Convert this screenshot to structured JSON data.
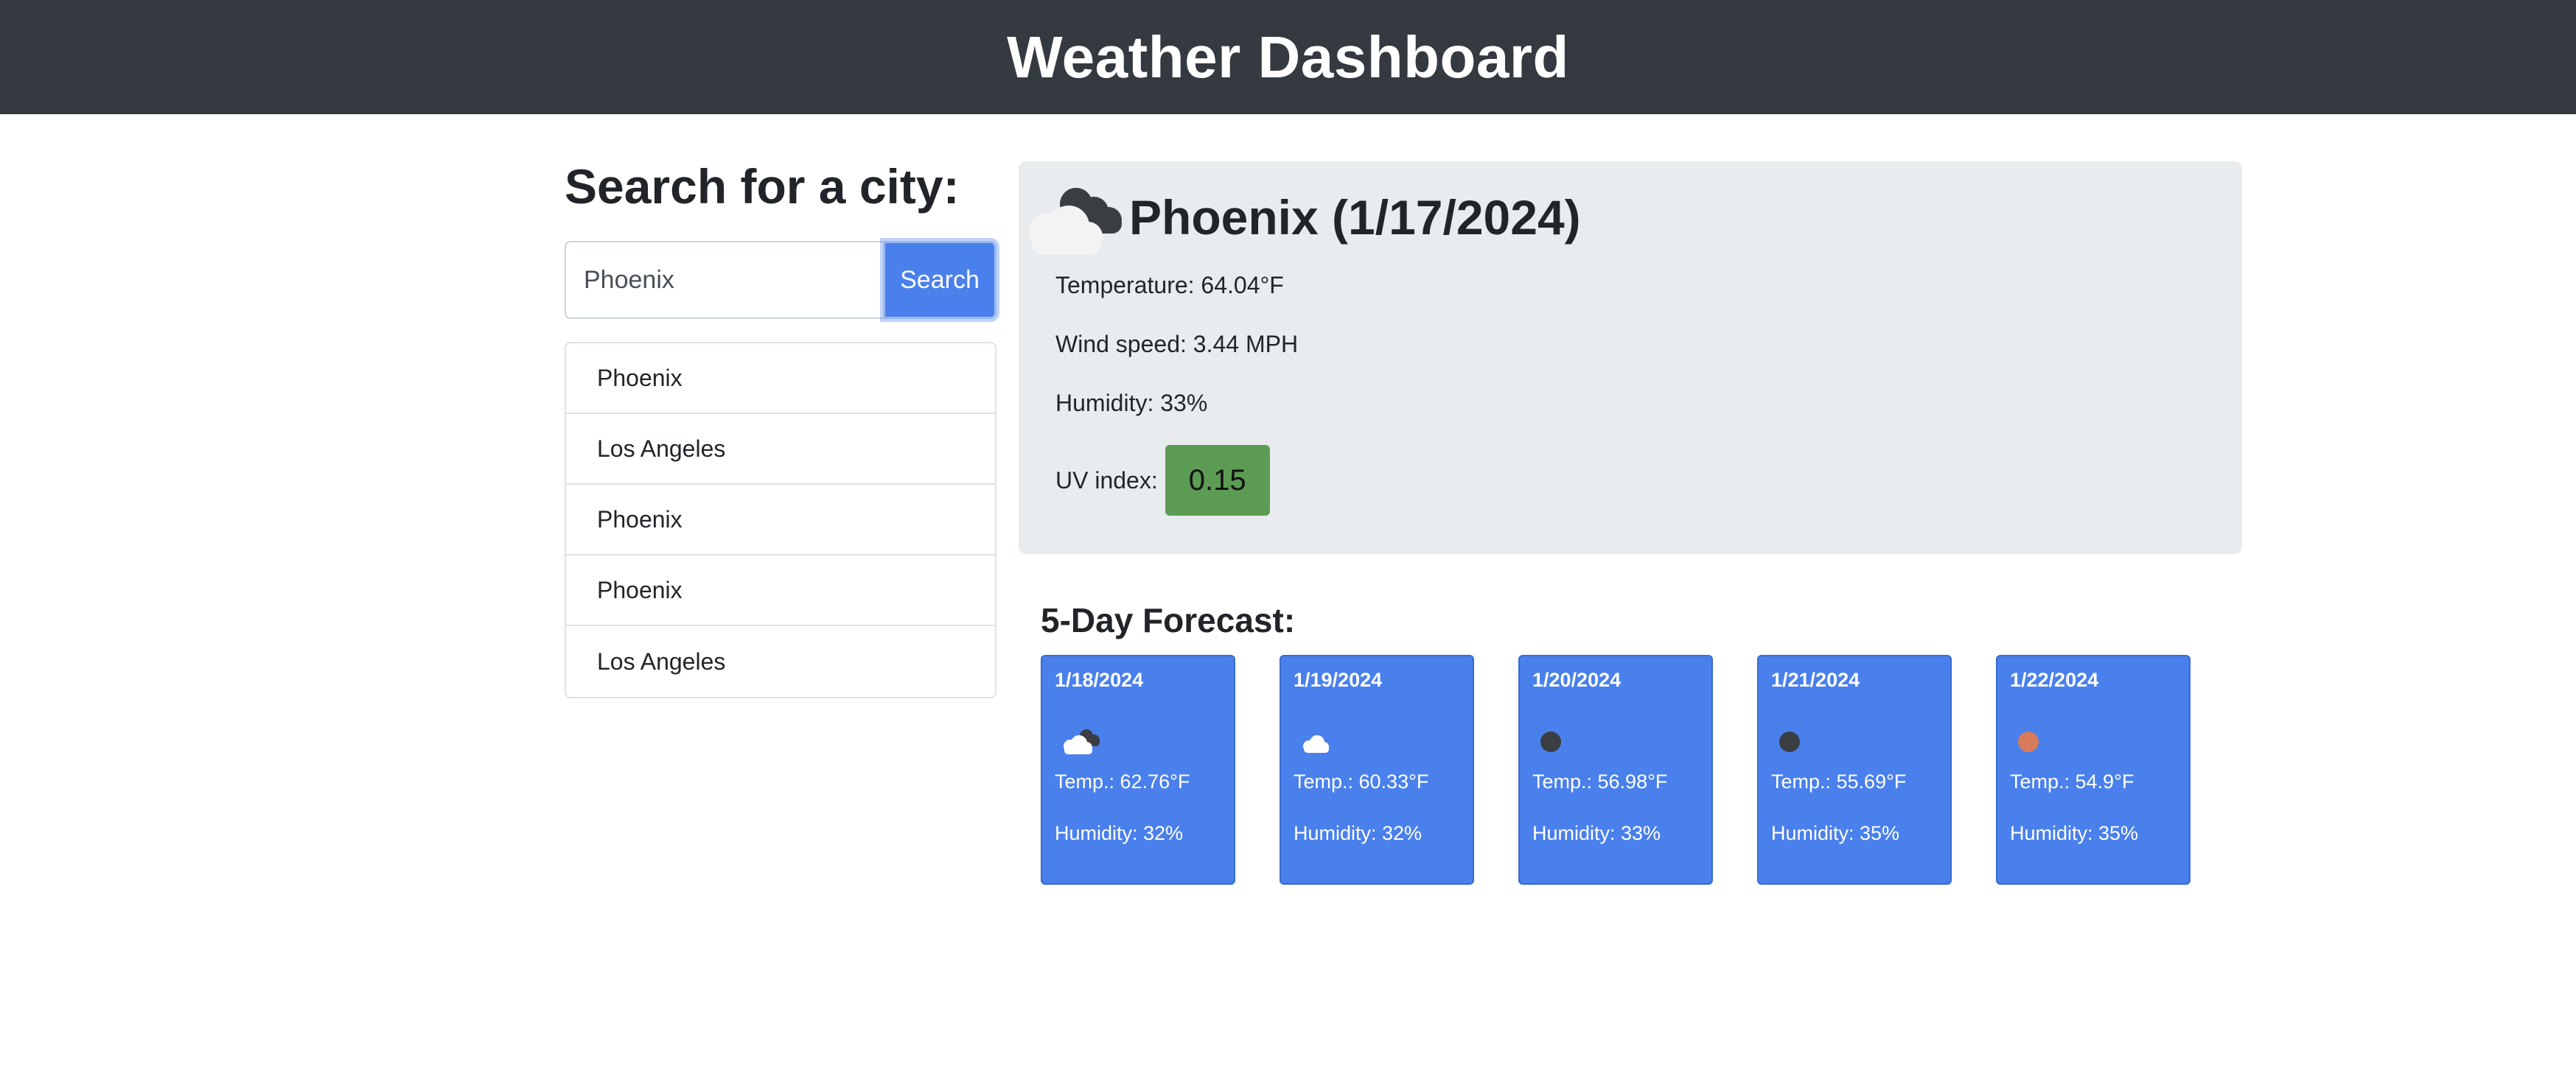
{
  "header": {
    "title": "Weather Dashboard"
  },
  "search": {
    "title": "Search for a city:",
    "input_value": "Phoenix",
    "button_label": "Search"
  },
  "history": {
    "items": [
      {
        "label": "Phoenix"
      },
      {
        "label": "Los Angeles"
      },
      {
        "label": "Phoenix"
      },
      {
        "label": "Phoenix"
      },
      {
        "label": "Los Angeles"
      }
    ]
  },
  "current": {
    "heading": "Phoenix (1/17/2024)",
    "icon": "broken-clouds-icon",
    "temperature": "Temperature: 64.04°F",
    "wind": "Wind speed: 3.44 MPH",
    "humidity": "Humidity: 33%",
    "uv_label": "UV index:",
    "uv_value": "0.15",
    "uv_color": "#5c9b54"
  },
  "forecast": {
    "title": "5-Day Forecast:",
    "card_color": "#4a80eb",
    "days": [
      {
        "date": "1/18/2024",
        "icon": "broken-clouds-icon",
        "temp": "Temp.: 62.76°F",
        "humidity": "Humidity: 32%"
      },
      {
        "date": "1/19/2024",
        "icon": "few-clouds-icon",
        "temp": "Temp.: 60.33°F",
        "humidity": "Humidity: 32%"
      },
      {
        "date": "1/20/2024",
        "icon": "clear-night-icon",
        "temp": "Temp.: 56.98°F",
        "humidity": "Humidity: 33%"
      },
      {
        "date": "1/21/2024",
        "icon": "clear-night-icon",
        "temp": "Temp.: 55.69°F",
        "humidity": "Humidity: 35%"
      },
      {
        "date": "1/22/2024",
        "icon": "clear-sun-icon",
        "temp": "Temp.: 54.9°F",
        "humidity": "Humidity: 35%"
      }
    ]
  }
}
